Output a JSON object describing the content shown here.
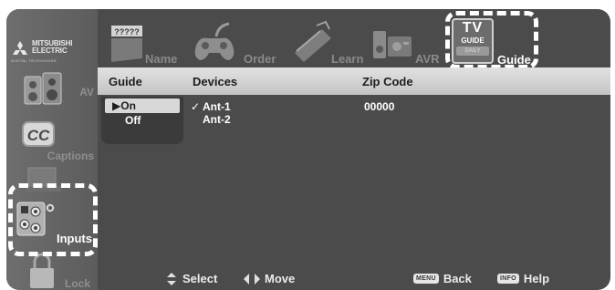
{
  "brand": {
    "line1": "MITSUBISHI",
    "line2": "ELECTRIC",
    "tagline": "DIGITAL TELEVISIONS"
  },
  "top_tabs": [
    {
      "label": "Name",
      "icon": "name-tag-icon"
    },
    {
      "label": "Order",
      "icon": "game-controller-icon"
    },
    {
      "label": "Learn",
      "icon": "learn-device-icon"
    },
    {
      "label": "AVR",
      "icon": "avr-receiver-icon"
    },
    {
      "label": "Guide",
      "icon": "tv-guide-icon",
      "selected": true
    }
  ],
  "tv_guide_logo": {
    "line1": "TV",
    "line2": "GUIDE",
    "line3": "DAILY"
  },
  "name_icon_text": "?????",
  "sidebar": [
    {
      "label": "AV",
      "icon": "speaker-icon"
    },
    {
      "label": "Captions",
      "icon": "cc-icon"
    },
    {
      "label": "Inputs",
      "icon": "inputs-jack-icon",
      "selected": true
    },
    {
      "label": "Lock",
      "icon": "padlock-icon"
    }
  ],
  "header": {
    "guide": "Guide",
    "devices": "Devices",
    "zip_code": "Zip Code"
  },
  "guide_options": [
    {
      "label": "On",
      "marker": "▶",
      "selected": true
    },
    {
      "label": "Off",
      "selected": false
    }
  ],
  "devices": [
    {
      "label": "Ant-1",
      "checked": true,
      "check": "✓"
    },
    {
      "label": "Ant-2",
      "checked": false
    }
  ],
  "zip_code_value": "00000",
  "footer": {
    "select": "Select",
    "move": "Move",
    "back_badge": "MENU",
    "back": "Back",
    "help_badge": "INFO",
    "help": "Help"
  },
  "colors": {
    "background": "#4b4b4b",
    "header": "#d4d4d4",
    "highlight": "#ffffff"
  }
}
